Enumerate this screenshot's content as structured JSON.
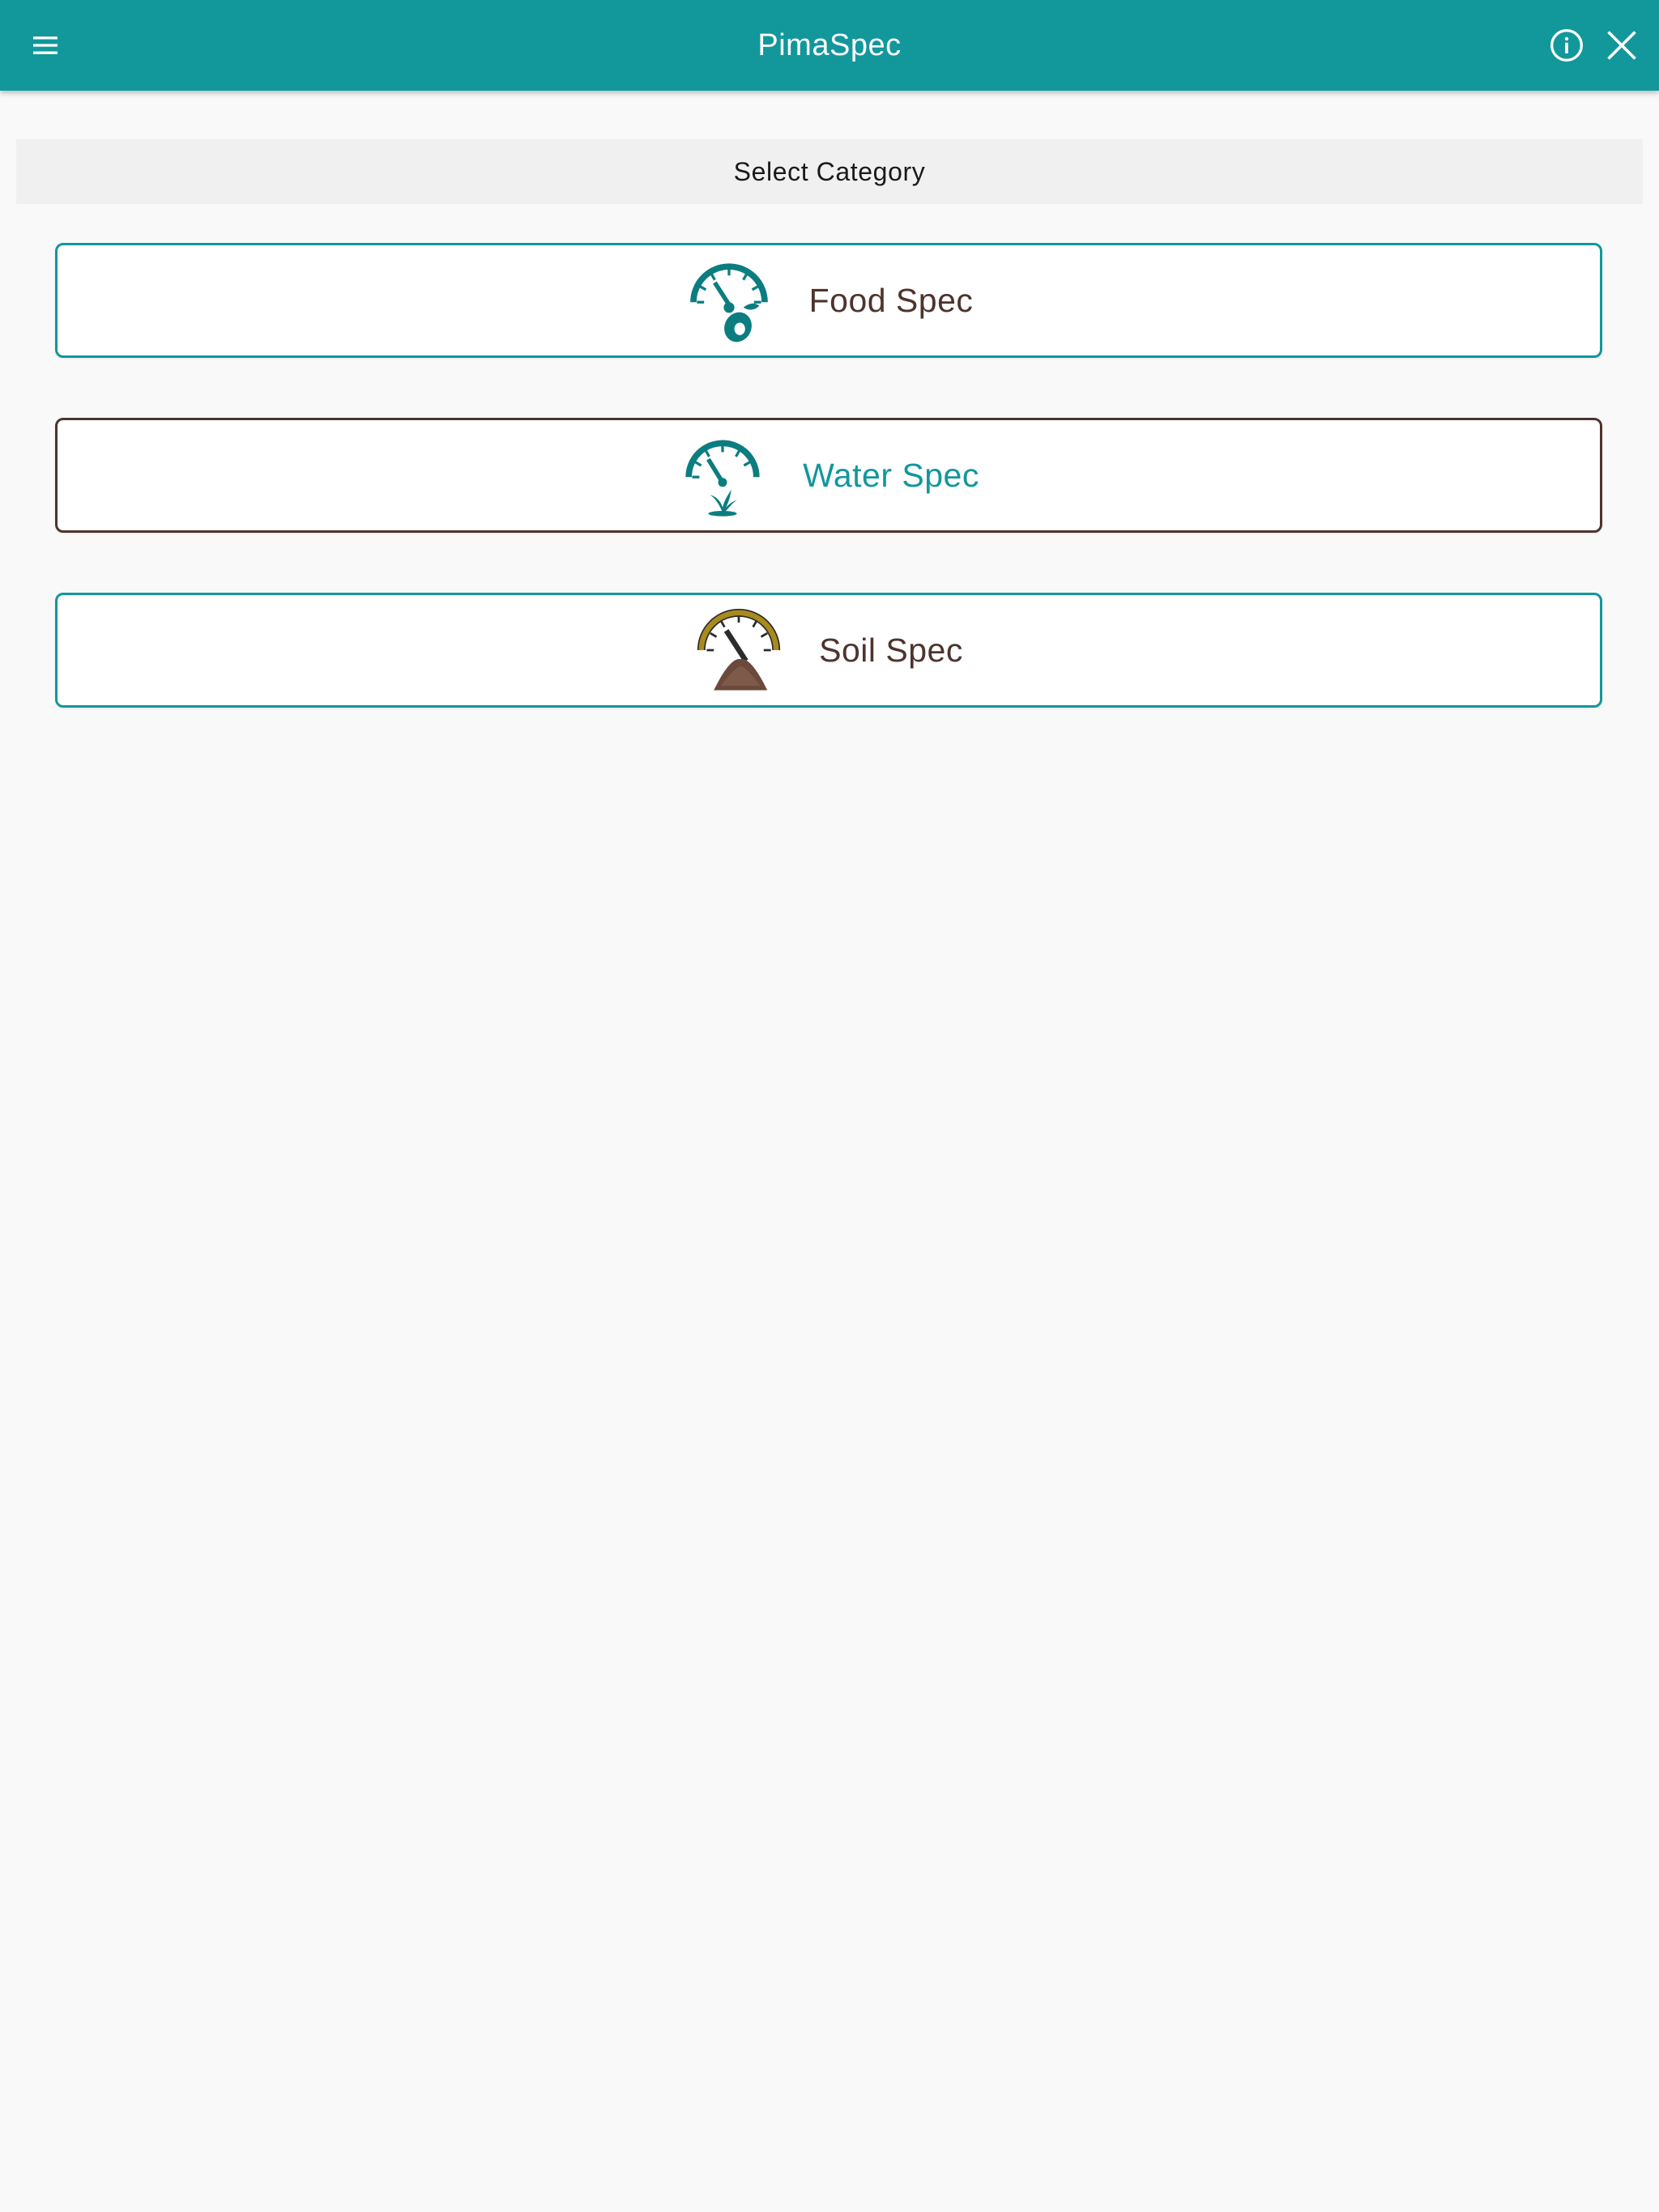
{
  "app_bar": {
    "title": "PimaSpec",
    "menu_icon": "hamburger-menu-icon",
    "info_icon": "info-icon",
    "close_icon": "close-icon",
    "background_color": "#12979b"
  },
  "section_header": {
    "label": "Select Category"
  },
  "categories": [
    {
      "label": "Food Spec",
      "icon": "food-gauge-icon",
      "border_color": "#12979b",
      "label_color": "#4e342e"
    },
    {
      "label": "Water Spec",
      "icon": "water-gauge-icon",
      "border_color": "#4e342e",
      "label_color": "#12979b"
    },
    {
      "label": "Soil Spec",
      "icon": "soil-gauge-icon",
      "border_color": "#12979b",
      "label_color": "#4e342e"
    }
  ]
}
